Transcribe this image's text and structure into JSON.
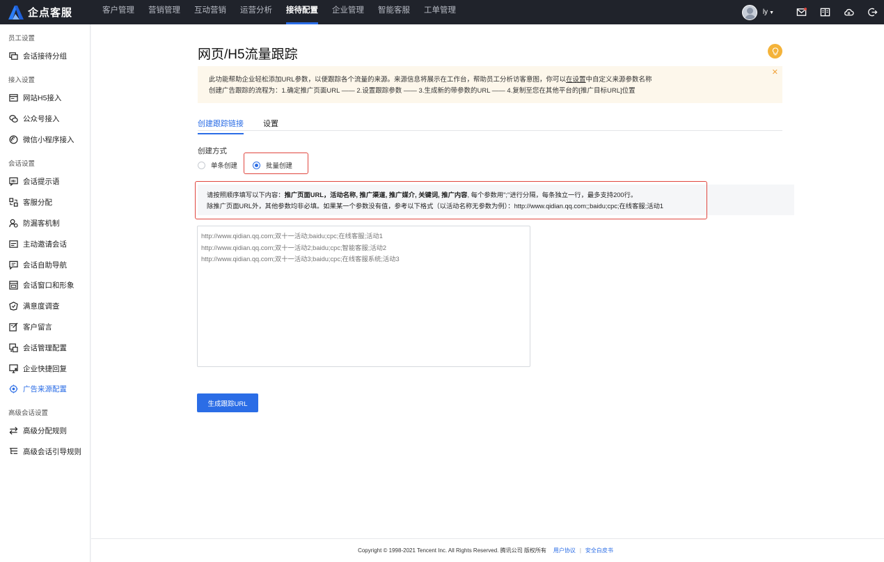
{
  "topbar": {
    "brand": "企点客服",
    "nav": [
      "客户管理",
      "营销管理",
      "互动营销",
      "运营分析",
      "接待配置",
      "企业管理",
      "智能客服",
      "工单管理"
    ],
    "active_nav": "接待配置",
    "user": "ly"
  },
  "sidebar": {
    "groups": {
      "staff": "员工设置",
      "access": "接入设置",
      "session": "会话设置",
      "advanced": "高级会话设置"
    },
    "items": {
      "reception_group": "会话接待分组",
      "web_h5": "网站H5接入",
      "official_account": "公众号接入",
      "mini_program": "微信小程序接入",
      "prompt": "会话提示语",
      "assign": "客服分配",
      "anti_leak": "防漏客机制",
      "invite": "主动邀请会话",
      "self_nav": "会话自助导航",
      "window": "会话窗口和形象",
      "survey": "满意度调查",
      "message": "客户留言",
      "management": "会话管理配置",
      "quick_reply": "企业快捷回复",
      "ad_source": "广告来源配置",
      "adv_assign": "高级分配规则",
      "adv_guide": "高级会话引导规则"
    },
    "active_item": "广告来源配置"
  },
  "main": {
    "title": "网页/H5流量跟踪",
    "notice_line1_a": "此功能帮助企业轻松添加URL参数，以便跟踪各个流量的来源。来源信息将展示在工作台，帮助员工分析访客意图，你可以",
    "notice_line1_link": "在设置",
    "notice_line1_b": "中自定义来源参数名称",
    "notice_line2": "创建广告跟踪的流程为：1.确定推广页面URL —— 2.设置跟踪参数 —— 3.生成新的带参数的URL —— 4.复制至您在其他平台的[推广目标URL]位置",
    "tabs": [
      "创建跟踪链接",
      "设置"
    ],
    "create_mode_label": "创建方式",
    "radio_single": "单条创建",
    "radio_batch": "批量创建",
    "hint_line1_a": "请按照顺序填写以下内容：",
    "hint_line1_b": "推广页面URL，活动名称, 推广渠道, 推广媒介, 关键词, 推广内容",
    "hint_line1_c": ", 每个参数用\";\"进行分隔，每条独立一行，最多支持200行。",
    "hint_line2": "除推广页面URL外，其他参数均非必填。如果某一个参数没有值，参考以下格式（以活动名称无参数为例）：http://www.qidian.qq.com;;baidu;cpc;在线客服;活动1",
    "placeholder": "http://www.qidian.qq.com;双十一活动;baidu;cpc;在线客服;活动1\nhttp://www.qidian.qq.com;双十一活动2;baidu;cpc;智能客服;活动2\nhttp://www.qidian.qq.com;双十一活动3;baidu;cpc;在线客服系统;活动3",
    "generate_button": "生成跟踪URL"
  },
  "footer": {
    "copyright": "Copyright © 1998-2021 Tencent Inc. All Rights Reserved. 腾讯公司 版权所有",
    "link_agreement": "用户协议",
    "separator": "|",
    "link_security": "安全白皮书"
  },
  "colors": {
    "accent": "#2b6de6",
    "topbar_bg": "#20232b",
    "highlight_red": "#e0463e",
    "notice_bg": "#fdf7eb",
    "bulb": "#f4b33a"
  }
}
